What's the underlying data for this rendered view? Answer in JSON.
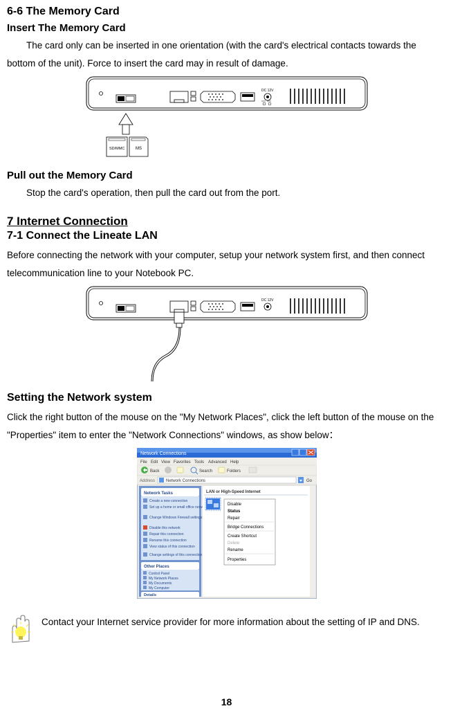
{
  "section6": {
    "heading": "6-6 The Memory Card",
    "sub1": "Insert The Memory Card",
    "p1": "The card only can be inserted in one orientation (with the card's electrical contacts towards the bottom of the unit). Force to insert the card may in result of damage.",
    "sub2": "Pull out the Memory Card",
    "p2": "Stop the card's operation, then pull the card out from the port."
  },
  "section7": {
    "heading": "7 Internet Connection",
    "sub1": "7-1 Connect the Lineate LAN",
    "p1": "Before connecting the network with your computer, setup your network system first, and then connect telecommunication line to your Notebook PC.",
    "sub2": "Setting the Network system",
    "p2": "Click the right button of the mouse on the \"My Network Places\", click the left button of the mouse on the \"Properties\" item to enter the \"Network Connections\" windows, as show below："
  },
  "tip": {
    "text": "Contact your Internet service provider for more information about the setting of IP and DNS."
  },
  "pageNumber": "18",
  "fig1": {
    "dc_label": "DC 12V",
    "card_left": "SD/MMC",
    "card_right": "MS"
  },
  "fig2": {
    "dc_label": "DC 12V"
  },
  "fig3": {
    "window_title": "Network Connections",
    "menu": [
      "File",
      "Edit",
      "View",
      "Favorites",
      "Tools",
      "Advanced",
      "Help"
    ],
    "toolbar_back": "Back",
    "toolbar_search": "Search",
    "toolbar_folders": "Folders",
    "address_label": "Address",
    "address_value": "Network Connections",
    "go_label": "Go",
    "tasks_header": "Network Tasks",
    "tasks": [
      "Create a new connection",
      "Set up a home or small office network",
      "Change Windows Firewall settings",
      "Disable this network",
      "Repair this connection",
      "Rename this connection",
      "View status of this connection",
      "Change settings of this connection"
    ],
    "other_header": "Other Places",
    "other": [
      "Control Panel",
      "My Network Places",
      "My Documents",
      "My Computer"
    ],
    "details_header": "Details",
    "group_header": "LAN or High-Speed Internet",
    "context_menu": [
      "Disable",
      "Status",
      "Repair",
      "Bridge Connections",
      "Create Shortcut",
      "Delete",
      "Rename",
      "Properties"
    ]
  }
}
